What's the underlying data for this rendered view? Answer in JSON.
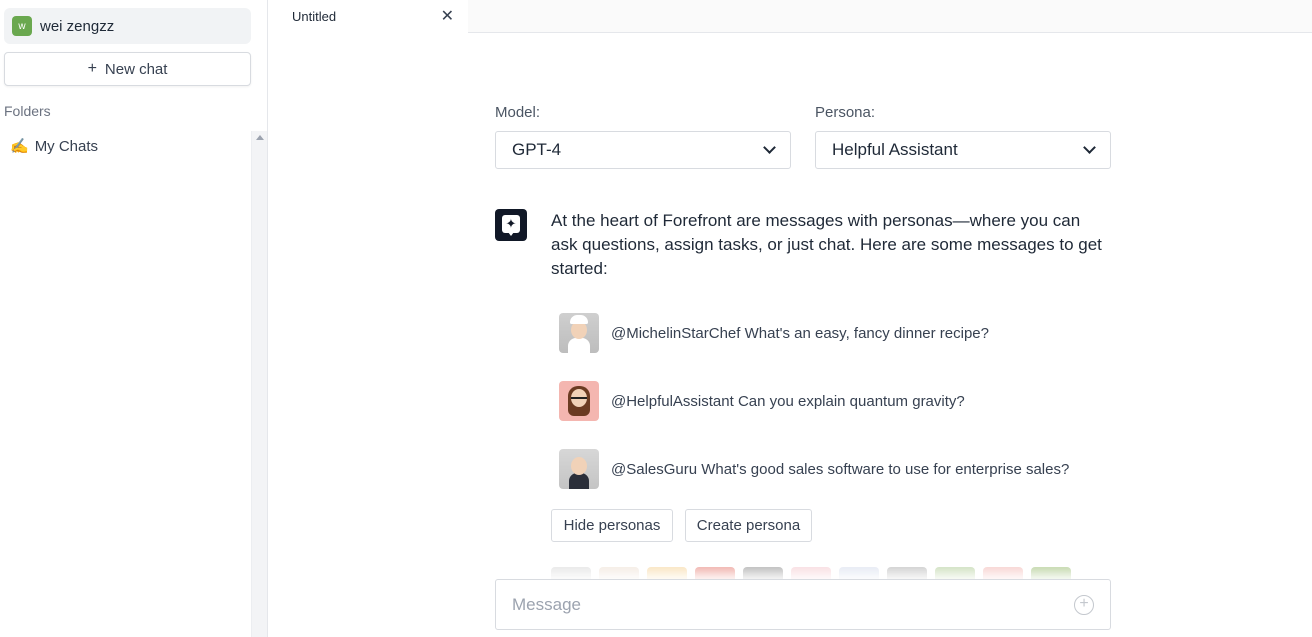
{
  "sidebar": {
    "user": {
      "initial": "w",
      "name": "wei zengzz"
    },
    "new_chat_label": "New chat",
    "folders_label": "Folders",
    "folders": [
      {
        "emoji": "✍️",
        "label": "My Chats"
      }
    ]
  },
  "tabs": [
    {
      "label": "Untitled"
    }
  ],
  "selectors": {
    "model_label": "Model:",
    "model_value": "GPT-4",
    "persona_label": "Persona:",
    "persona_value": "Helpful Assistant"
  },
  "intro_message": "At the heart of Forefront are messages with personas—where you can ask questions, assign tasks, or just chat. Here are some messages to get started:",
  "suggestions": [
    {
      "text": "@MichelinStarChef What's an easy, fancy dinner recipe?",
      "avatar": "chef"
    },
    {
      "text": "@HelpfulAssistant Can you explain quantum gravity?",
      "avatar": "assistant"
    },
    {
      "text": "@SalesGuru What's good sales software to use for enterprise sales?",
      "avatar": "sales"
    }
  ],
  "buttons": {
    "hide_personas": "Hide personas",
    "create_persona": "Create persona"
  },
  "persona_thumb_colors": [
    "#cfcfcf",
    "#e8d6c8",
    "#f3c77a",
    "#e05a4e",
    "#6f6f6f",
    "#f2b9c0",
    "#c9d2e6",
    "#9c9c9c",
    "#9bbf7b",
    "#f0a5a0",
    "#7faa4c"
  ],
  "composer": {
    "placeholder": "Message"
  },
  "colors": {
    "accent_avatar": "#6aa84f",
    "bot_icon": "#111827"
  }
}
